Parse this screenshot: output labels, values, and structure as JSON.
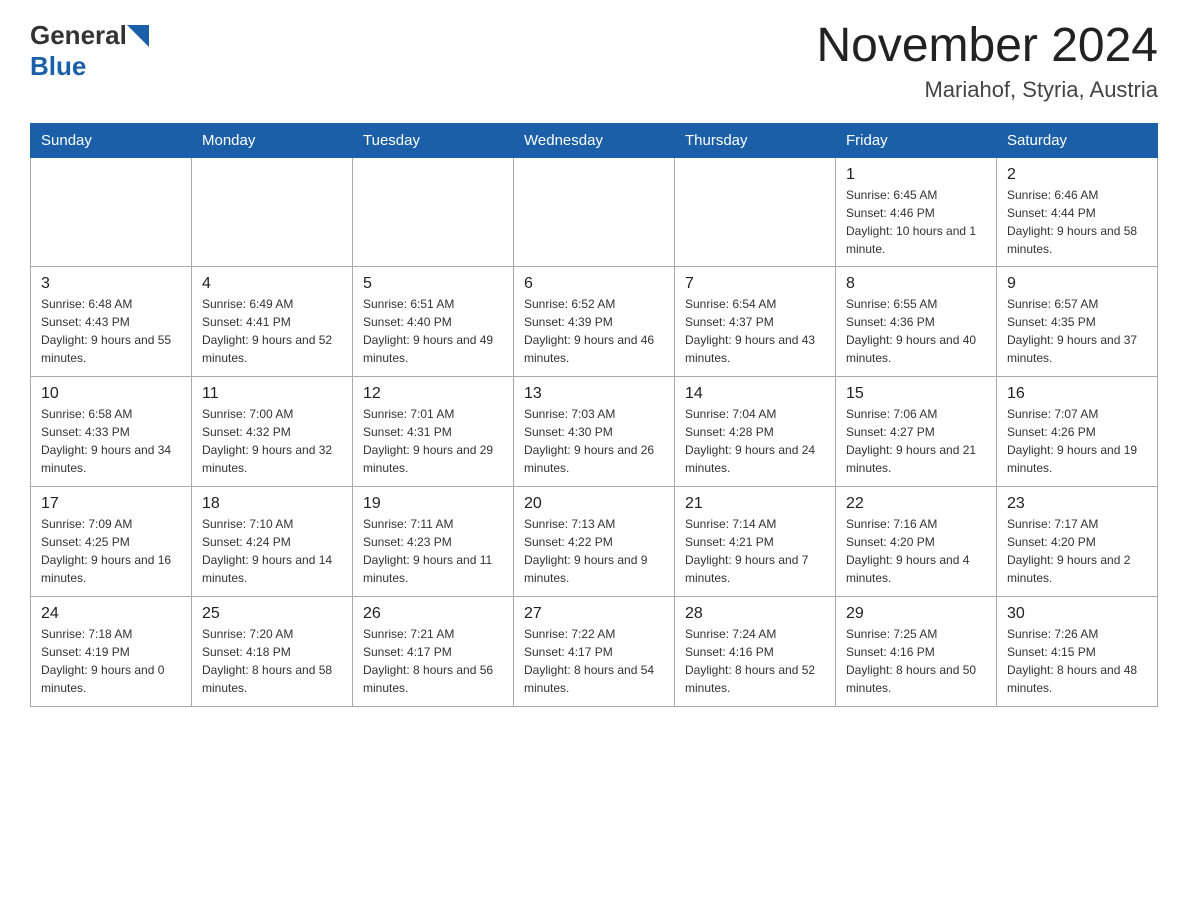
{
  "header": {
    "logo_general": "General",
    "logo_blue": "Blue",
    "month_title": "November 2024",
    "location": "Mariahof, Styria, Austria"
  },
  "weekdays": [
    "Sunday",
    "Monday",
    "Tuesday",
    "Wednesday",
    "Thursday",
    "Friday",
    "Saturday"
  ],
  "weeks": [
    [
      {
        "day": "",
        "info": ""
      },
      {
        "day": "",
        "info": ""
      },
      {
        "day": "",
        "info": ""
      },
      {
        "day": "",
        "info": ""
      },
      {
        "day": "",
        "info": ""
      },
      {
        "day": "1",
        "info": "Sunrise: 6:45 AM\nSunset: 4:46 PM\nDaylight: 10 hours and 1 minute."
      },
      {
        "day": "2",
        "info": "Sunrise: 6:46 AM\nSunset: 4:44 PM\nDaylight: 9 hours and 58 minutes."
      }
    ],
    [
      {
        "day": "3",
        "info": "Sunrise: 6:48 AM\nSunset: 4:43 PM\nDaylight: 9 hours and 55 minutes."
      },
      {
        "day": "4",
        "info": "Sunrise: 6:49 AM\nSunset: 4:41 PM\nDaylight: 9 hours and 52 minutes."
      },
      {
        "day": "5",
        "info": "Sunrise: 6:51 AM\nSunset: 4:40 PM\nDaylight: 9 hours and 49 minutes."
      },
      {
        "day": "6",
        "info": "Sunrise: 6:52 AM\nSunset: 4:39 PM\nDaylight: 9 hours and 46 minutes."
      },
      {
        "day": "7",
        "info": "Sunrise: 6:54 AM\nSunset: 4:37 PM\nDaylight: 9 hours and 43 minutes."
      },
      {
        "day": "8",
        "info": "Sunrise: 6:55 AM\nSunset: 4:36 PM\nDaylight: 9 hours and 40 minutes."
      },
      {
        "day": "9",
        "info": "Sunrise: 6:57 AM\nSunset: 4:35 PM\nDaylight: 9 hours and 37 minutes."
      }
    ],
    [
      {
        "day": "10",
        "info": "Sunrise: 6:58 AM\nSunset: 4:33 PM\nDaylight: 9 hours and 34 minutes."
      },
      {
        "day": "11",
        "info": "Sunrise: 7:00 AM\nSunset: 4:32 PM\nDaylight: 9 hours and 32 minutes."
      },
      {
        "day": "12",
        "info": "Sunrise: 7:01 AM\nSunset: 4:31 PM\nDaylight: 9 hours and 29 minutes."
      },
      {
        "day": "13",
        "info": "Sunrise: 7:03 AM\nSunset: 4:30 PM\nDaylight: 9 hours and 26 minutes."
      },
      {
        "day": "14",
        "info": "Sunrise: 7:04 AM\nSunset: 4:28 PM\nDaylight: 9 hours and 24 minutes."
      },
      {
        "day": "15",
        "info": "Sunrise: 7:06 AM\nSunset: 4:27 PM\nDaylight: 9 hours and 21 minutes."
      },
      {
        "day": "16",
        "info": "Sunrise: 7:07 AM\nSunset: 4:26 PM\nDaylight: 9 hours and 19 minutes."
      }
    ],
    [
      {
        "day": "17",
        "info": "Sunrise: 7:09 AM\nSunset: 4:25 PM\nDaylight: 9 hours and 16 minutes."
      },
      {
        "day": "18",
        "info": "Sunrise: 7:10 AM\nSunset: 4:24 PM\nDaylight: 9 hours and 14 minutes."
      },
      {
        "day": "19",
        "info": "Sunrise: 7:11 AM\nSunset: 4:23 PM\nDaylight: 9 hours and 11 minutes."
      },
      {
        "day": "20",
        "info": "Sunrise: 7:13 AM\nSunset: 4:22 PM\nDaylight: 9 hours and 9 minutes."
      },
      {
        "day": "21",
        "info": "Sunrise: 7:14 AM\nSunset: 4:21 PM\nDaylight: 9 hours and 7 minutes."
      },
      {
        "day": "22",
        "info": "Sunrise: 7:16 AM\nSunset: 4:20 PM\nDaylight: 9 hours and 4 minutes."
      },
      {
        "day": "23",
        "info": "Sunrise: 7:17 AM\nSunset: 4:20 PM\nDaylight: 9 hours and 2 minutes."
      }
    ],
    [
      {
        "day": "24",
        "info": "Sunrise: 7:18 AM\nSunset: 4:19 PM\nDaylight: 9 hours and 0 minutes."
      },
      {
        "day": "25",
        "info": "Sunrise: 7:20 AM\nSunset: 4:18 PM\nDaylight: 8 hours and 58 minutes."
      },
      {
        "day": "26",
        "info": "Sunrise: 7:21 AM\nSunset: 4:17 PM\nDaylight: 8 hours and 56 minutes."
      },
      {
        "day": "27",
        "info": "Sunrise: 7:22 AM\nSunset: 4:17 PM\nDaylight: 8 hours and 54 minutes."
      },
      {
        "day": "28",
        "info": "Sunrise: 7:24 AM\nSunset: 4:16 PM\nDaylight: 8 hours and 52 minutes."
      },
      {
        "day": "29",
        "info": "Sunrise: 7:25 AM\nSunset: 4:16 PM\nDaylight: 8 hours and 50 minutes."
      },
      {
        "day": "30",
        "info": "Sunrise: 7:26 AM\nSunset: 4:15 PM\nDaylight: 8 hours and 48 minutes."
      }
    ]
  ]
}
